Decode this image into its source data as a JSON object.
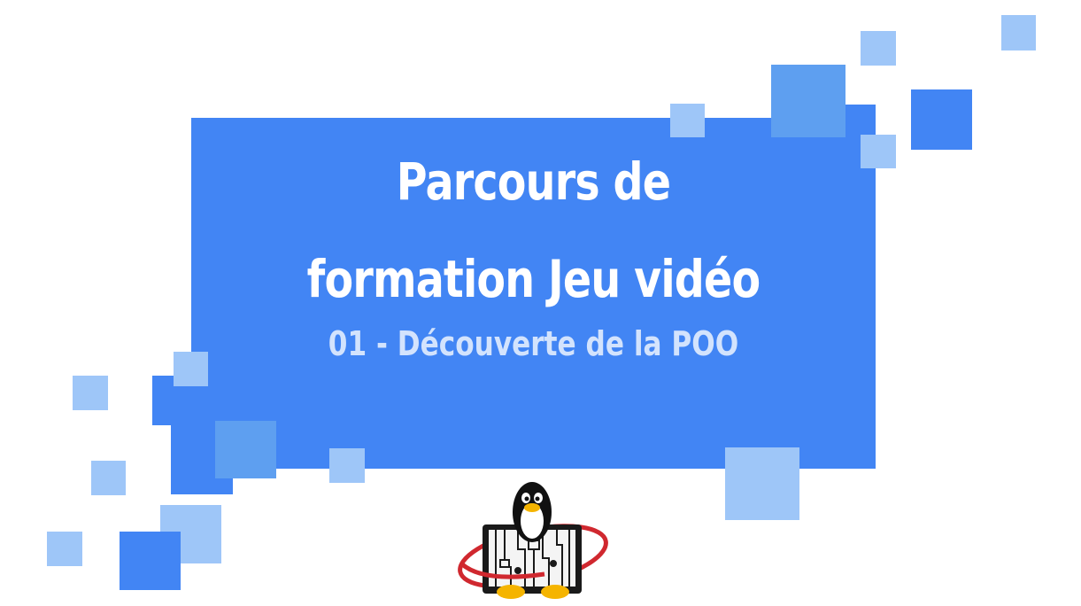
{
  "title": {
    "line1": "Parcours de",
    "line2": "formation Jeu vidéo"
  },
  "subtitle": "01 - Découverte de la POO",
  "colors": {
    "primary": "#4285f4",
    "mid": "#5e9ff0",
    "light": "#9ec6f8",
    "subtitle": "#d3e3fd",
    "logo_ring": "#d0282f"
  },
  "logo": {
    "icon": "tux-penguin-circuit-board-logo"
  }
}
